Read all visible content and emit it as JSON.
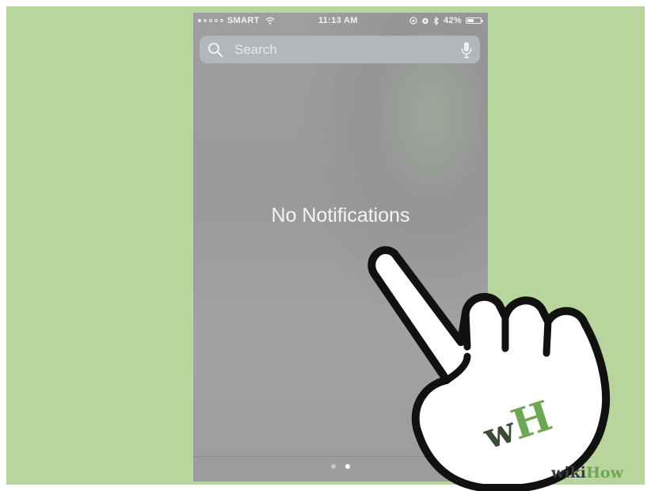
{
  "status_bar": {
    "carrier": "SMART",
    "time": "11:13 AM",
    "battery": "42%",
    "battery_level": 0.42
  },
  "search": {
    "placeholder": "Search"
  },
  "main": {
    "empty_message": "No Notifications"
  },
  "pager": {
    "pages": 2,
    "active_index": 1
  },
  "watermark": {
    "wiki": "wiki",
    "how": "How",
    "logo_letters": "wH"
  },
  "icons": [
    "search-icon",
    "microphone-icon",
    "wifi-icon",
    "alarm-icon",
    "bluetooth-icon",
    "rotation-lock-icon",
    "battery-icon",
    "pointing-hand-icon"
  ],
  "colors": {
    "background_panel": "#b9d59e",
    "screen": "#9e9e9e",
    "wikihow_green": "#6fa654"
  }
}
